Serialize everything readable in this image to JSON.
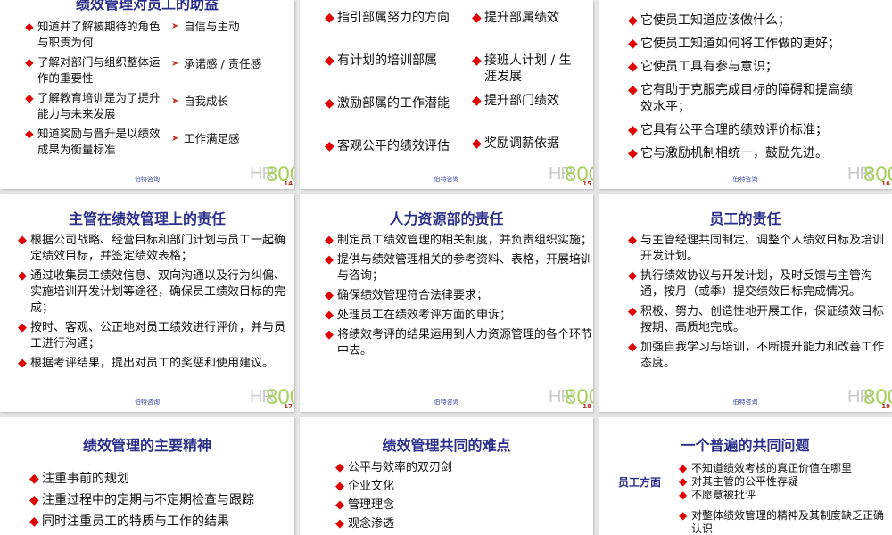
{
  "footer_text": "伯特咨询",
  "logo_text": "HR800",
  "slides": [
    {
      "id": "s14",
      "number": "14",
      "title": "绩效管理对员工的助益",
      "columns": [
        {
          "marker": "diamond",
          "items": [
            "知道并了解被期待的角色与职责为何",
            "了解对部门与组织整体运作的重要性",
            "了解教育培训是为了提升能力与未来发展",
            "知道奖励与晋升是以绩效成果为衡量标准"
          ]
        },
        {
          "marker": "arrow",
          "items": [
            "自信与主动",
            "承诺感 / 责任感",
            "自我成长",
            "工作满足感"
          ]
        }
      ]
    },
    {
      "id": "s15",
      "number": "15",
      "columns": [
        {
          "marker": "diamond",
          "items": [
            "指引部属努力的方向",
            "有计划的培训部属",
            "激励部属的工作潜能",
            "客观公平的绩效评估"
          ]
        },
        {
          "marker": "diamond",
          "items": [
            "提升部属绩效",
            "接班人计划 / 生涯发展",
            "提升部门绩效",
            "奖励调薪依据"
          ]
        }
      ]
    },
    {
      "id": "s16",
      "number": "16",
      "columns": [
        {
          "marker": "diamond",
          "items": [
            "它使员工知道应该做什么；",
            "它使员工知道如何将工作做的更好；",
            "它使员工具有参与意识；",
            "它有助于克服完成目标的障碍和提高绩效水平；",
            "它具有公平合理的绩效评价标准；",
            "它与激励机制相统一，鼓励先进。"
          ]
        }
      ]
    },
    {
      "id": "s17",
      "number": "17",
      "title": "主管在绩效管理上的责任",
      "columns": [
        {
          "marker": "diamond",
          "items": [
            "根据公司战略、经营目标和部门计划与员工一起确定绩效目标，并签定绩效表格；",
            "通过收集员工绩效信息、双向沟通以及行为纠偏、实施培训开发计划等途径，确保员工绩效目标的完成；",
            "按时、客观、公正地对员工绩效进行评价，并与员工进行沟通；",
            "根据考评结果，提出对员工的奖惩和使用建议。"
          ]
        }
      ]
    },
    {
      "id": "s18",
      "number": "18",
      "title": "人力资源部的责任",
      "columns": [
        {
          "marker": "diamond",
          "items": [
            "制定员工绩效管理的相关制度，并负责组织实施；",
            "提供与绩效管理相关的参考资料、表格，开展培训与咨询；",
            "确保绩效管理符合法律要求；",
            "处理员工在绩效考评方面的申诉；",
            "将绩效考评的结果运用到人力资源管理的各个环节中去。"
          ]
        }
      ]
    },
    {
      "id": "s19",
      "number": "19",
      "title": "员工的责任",
      "columns": [
        {
          "marker": "diamond",
          "items": [
            "与主管经理共同制定、调整个人绩效目标及培训开发计划。",
            "执行绩效协议与开发计划，及时反馈与主管沟通，按月（或季）提交绩效目标完成情况。",
            "积极、努力、创造性地开展工作，保证绩效目标按期、高质地完成。",
            "加强自我学习与培训，不断提升能力和改善工作态度。"
          ]
        }
      ]
    },
    {
      "id": "s20",
      "title": "绩效管理的主要精神",
      "columns": [
        {
          "marker": "diamond",
          "items": [
            "注重事前的规划",
            "注重过程中的定期与不定期检查与跟踪",
            "同时注重员工的特质与工作的结果"
          ]
        }
      ]
    },
    {
      "id": "s21",
      "title": "绩效管理共同的难点",
      "columns": [
        {
          "marker": "diamond",
          "items": [
            "公平与效率的双刃剑",
            "企业文化",
            "管理理念",
            "观念渗透"
          ]
        }
      ]
    },
    {
      "id": "s22",
      "title": "一个普遍的共同问题",
      "label": "员工方面",
      "columns": [
        {
          "marker": "diamond",
          "items": [
            "不知道绩效考核的真正价值在哪里",
            "对其主管的公平性存疑",
            "不愿意被批评",
            "对整体绩效管理的精神及其制度缺乏正确认识"
          ]
        }
      ]
    }
  ]
}
